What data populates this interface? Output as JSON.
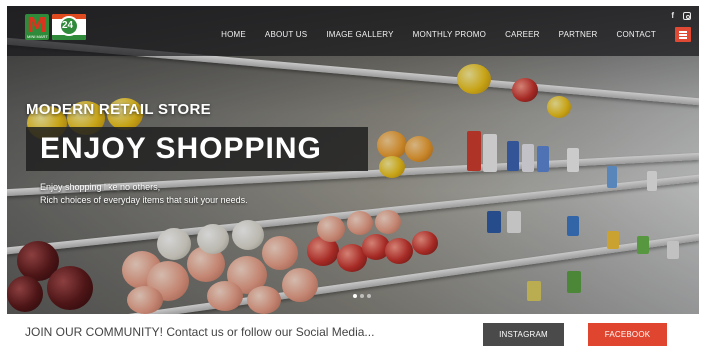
{
  "brand": {
    "logo_text": "M",
    "logo_subtext": "MINI MART",
    "badge_number": "24"
  },
  "social": {
    "facebook_glyph": "f"
  },
  "nav": {
    "items": [
      {
        "label": "HOME"
      },
      {
        "label": "ABOUT US"
      },
      {
        "label": "IMAGE GALLERY"
      },
      {
        "label": "MONTHLY PROMO"
      },
      {
        "label": "CAREER"
      },
      {
        "label": "PARTNER"
      },
      {
        "label": "CONTACT"
      }
    ]
  },
  "hero": {
    "kicker": "MODERN RETAIL STORE",
    "headline": "ENJOY SHOPPING",
    "description_line1": "Enjoy shopping like no others,",
    "description_line2": "Rich choices of everyday items that suit your needs.",
    "slides_total": 3,
    "slide_active": 1
  },
  "community": {
    "text": "JOIN OUR COMMUNITY! Contact us or follow our Social Media...",
    "instagram_label": "INSTAGRAM",
    "facebook_label": "FACEBOOK"
  },
  "colors": {
    "accent": "#e0452f",
    "dark_button": "#4a4a4a",
    "brand_green": "#2f8a3a"
  },
  "icons": {
    "facebook": "facebook-icon",
    "instagram": "instagram-icon",
    "menu": "hamburger-menu-icon"
  }
}
